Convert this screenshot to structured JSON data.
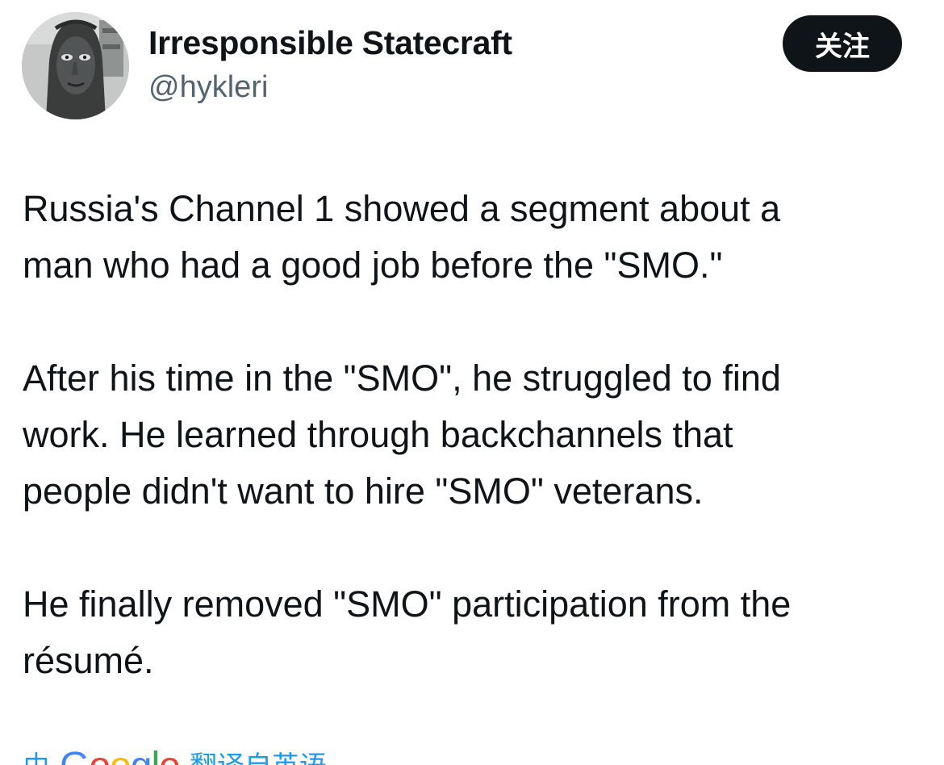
{
  "author": {
    "display_name": "Irresponsible Statecraft",
    "handle": "@hykleri",
    "avatar_icon": "sculpture-face-avatar"
  },
  "follow_button": {
    "label": "关注"
  },
  "tweet": {
    "paragraphs": [
      {
        "lines": [
          "Russia's Channel 1 showed a segment about a",
          "man who had a good job before the \"SMO.\""
        ]
      },
      {
        "lines": [
          "After his time in the \"SMO\", he struggled to find",
          "work. He learned through backchannels that",
          "people didn't want to hire \"SMO\" veterans."
        ]
      },
      {
        "lines": [
          "He finally removed \"SMO\" participation from the",
          "résumé."
        ]
      }
    ]
  },
  "translate": {
    "prefix": "由",
    "logo_text": "Google",
    "logo_colors": [
      "#4285F4",
      "#EA4335",
      "#FBBC05",
      "#4285F4",
      "#34A853",
      "#EA4335"
    ],
    "text": "翻译自英语",
    "link_color": "#1d9bf0"
  }
}
